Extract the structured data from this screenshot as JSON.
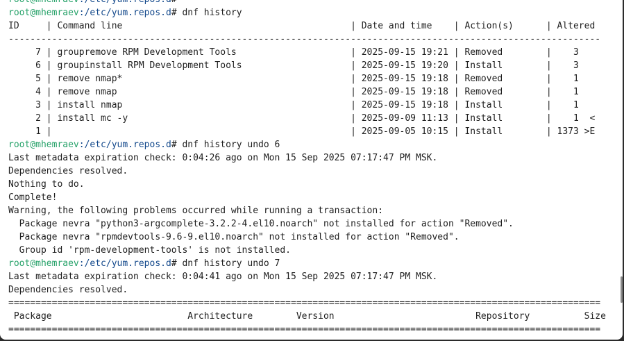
{
  "prompt": {
    "user_host": "root@mhemraev",
    "path": ":/etc/yum.repos.d",
    "symbol": "#"
  },
  "lines": [
    {
      "type": "prompt",
      "command": ""
    },
    {
      "type": "prompt",
      "command": " dnf history"
    },
    {
      "type": "text",
      "text": "ID     | Command line                                          | Date and time    | Action(s)      | Altered"
    },
    {
      "type": "text",
      "text": "-------------------------------------------------------------------------------------------------------------"
    },
    {
      "type": "text",
      "text": "     7 | groupremove RPM Development Tools                     | 2025-09-15 19:21 | Removed        |    3"
    },
    {
      "type": "text",
      "text": "     6 | groupinstall RPM Development Tools                    | 2025-09-15 19:20 | Install        |    3"
    },
    {
      "type": "text",
      "text": "     5 | remove nmap*                                          | 2025-09-15 19:18 | Removed        |    1"
    },
    {
      "type": "text",
      "text": "     4 | remove nmap                                           | 2025-09-15 19:18 | Removed        |    1"
    },
    {
      "type": "text",
      "text": "     3 | install nmap                                          | 2025-09-15 19:18 | Install        |    1"
    },
    {
      "type": "text",
      "text": "     2 | install mc -y                                         | 2025-09-09 11:13 | Install        |    1  <"
    },
    {
      "type": "text",
      "text": "     1 |                                                       | 2025-09-05 10:15 | Install        | 1373 >E"
    },
    {
      "type": "prompt",
      "command": " dnf history undo 6"
    },
    {
      "type": "text",
      "text": "Last metadata expiration check: 0:04:26 ago on Mon 15 Sep 2025 07:17:47 PM MSK."
    },
    {
      "type": "text",
      "text": "Dependencies resolved."
    },
    {
      "type": "text",
      "text": "Nothing to do."
    },
    {
      "type": "text",
      "text": "Complete!"
    },
    {
      "type": "text",
      "text": "Warning, the following problems occurred while running a transaction:"
    },
    {
      "type": "text",
      "text": "  Package nevra \"python3-argcomplete-3.2.2-4.el10.noarch\" not installed for action \"Removed\"."
    },
    {
      "type": "text",
      "text": "  Package nevra \"rpmdevtools-9.6-9.el10.noarch\" not installed for action \"Removed\"."
    },
    {
      "type": "text",
      "text": "  Group id 'rpm-development-tools' is not installed."
    },
    {
      "type": "prompt",
      "command": " dnf history undo 7"
    },
    {
      "type": "text",
      "text": "Last metadata expiration check: 0:04:41 ago on Mon 15 Sep 2025 07:17:47 PM MSK."
    },
    {
      "type": "text",
      "text": "Dependencies resolved."
    },
    {
      "type": "text",
      "text": "============================================================================================================="
    },
    {
      "type": "text",
      "text": " Package                         Architecture        Version                          Repository          Size"
    },
    {
      "type": "text",
      "text": "============================================================================================================="
    }
  ]
}
